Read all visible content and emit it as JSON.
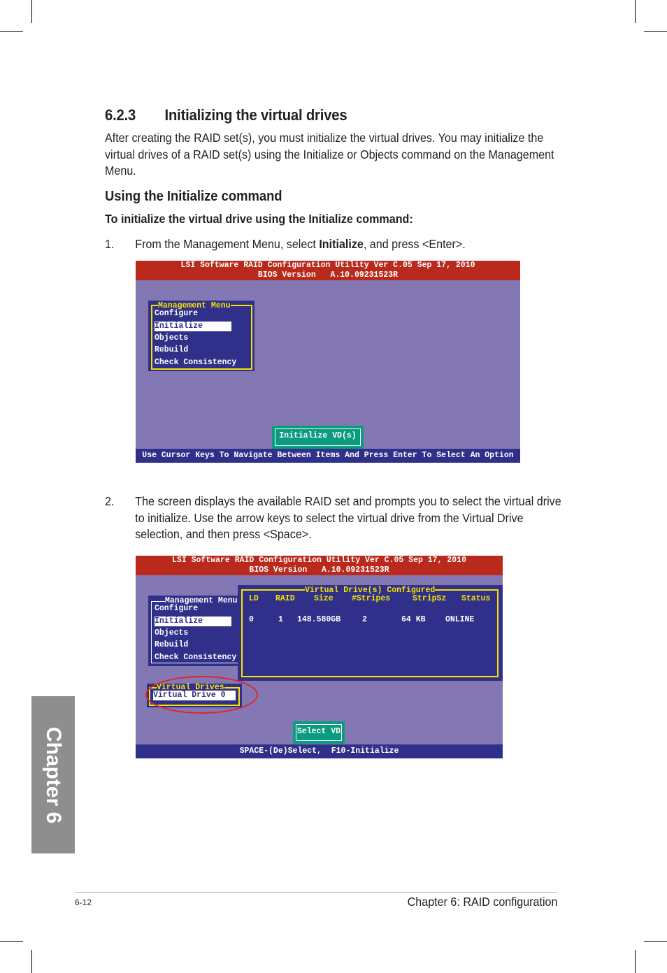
{
  "section": {
    "number": "6.2.3",
    "title": "Initializing the virtual drives",
    "intro": "After creating the RAID set(s), you must initialize the virtual drives. You may initialize the virtual drives of a RAID set(s) using the Initialize or Objects command on the Management Menu.",
    "subheading": "Using the Initialize command",
    "procedure_heading": "To initialize the virtual drive using the Initialize command:"
  },
  "steps": [
    {
      "number": "1.",
      "text_before": "From the Management Menu, select ",
      "bold": "Initialize",
      "text_after": ", and press <Enter>."
    },
    {
      "number": "2.",
      "text": "The screen displays the available RAID set and prompts you to select the virtual drive to initialize. Use the arrow keys to select the virtual drive from the Virtual Drive selection, and then press <Space>."
    }
  ],
  "screen1": {
    "header_line1": "LSI Software RAID Configuration Utility Ver C.05 Sep 17, 2010",
    "header_line2": "BIOS Version   A.10.09231523R",
    "menu_title": "Management Menu",
    "menu_items": [
      "Configure",
      "Initialize",
      "Objects",
      "Rebuild",
      "Check Consistency"
    ],
    "selected_item": "Initialize",
    "action_button": "Initialize VD(s)",
    "footer": "Use Cursor Keys To Navigate Between Items And Press Enter To Select An Option"
  },
  "screen2": {
    "header_line1": "LSI Software RAID Configuration Utility Ver C.05 Sep 17, 2010",
    "header_line2": "BIOS Version   A.10.09231523R",
    "menu_title": "Management Menu",
    "menu_items": [
      "Configure",
      "Initialize",
      "Objects",
      "Rebuild",
      "Check Consistency"
    ],
    "selected_item": "Initialize",
    "vd_panel_title": "Virtual Drive(s) Configured",
    "vd_columns": [
      "LD",
      "RAID",
      "Size",
      "#Stripes",
      "StripSz",
      "Status"
    ],
    "vd_rows": [
      {
        "LD": "0",
        "RAID": "1",
        "Size": "148.580GB",
        "Stripes": "2",
        "StripSz": "64 KB",
        "Status": "ONLINE"
      }
    ],
    "vdrives_title": "Virtual Drives",
    "vdrives_items": [
      "Virtual Drive 0"
    ],
    "action_button": "Select VD",
    "footer": "SPACE-(De)Select,  F10-Initialize",
    "highlight_color": "#e0242a"
  },
  "side_tab": "Chapter 6",
  "footer": {
    "page_number": "6-12",
    "chapter_title": "Chapter 6: RAID configuration"
  },
  "colors": {
    "bios_header": "#b9291c",
    "bios_background": "#8478b4",
    "bios_panel": "#30308a",
    "bios_frame": "#f5e400",
    "bios_button": "#0b9b80",
    "side_tab": "#8f8e8e"
  }
}
